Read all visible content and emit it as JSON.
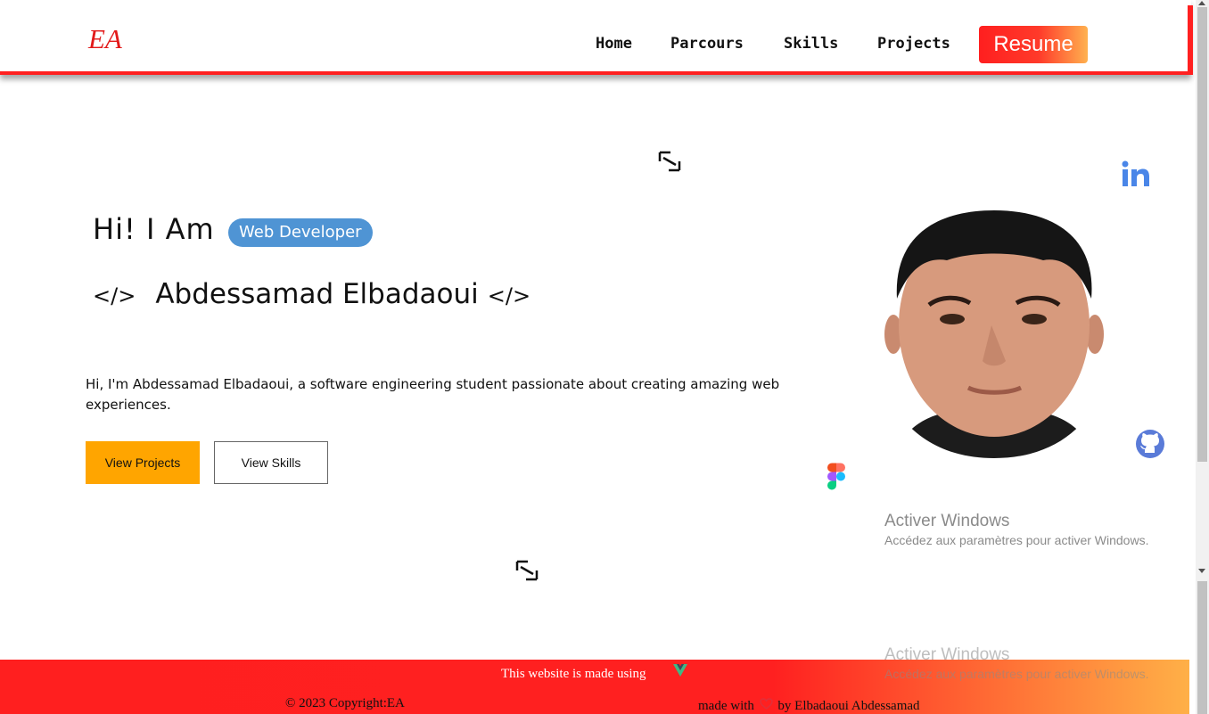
{
  "header": {
    "logo": "EA",
    "nav": [
      {
        "label": "Home"
      },
      {
        "label": "Parcours"
      },
      {
        "label": "Skills"
      },
      {
        "label": "Projects"
      }
    ],
    "resume_label": "Resume"
  },
  "hero": {
    "greeting": "Hi! I Am",
    "role_badge": "Web Developer",
    "code_open": "</>",
    "name": "Abdessamad Elbadaoui",
    "code_close": "</>",
    "intro": "Hi, I'm Abdessamad Elbadaoui, a software engineering student passionate about creating amazing web experiences.",
    "buttons": {
      "projects": "View Projects",
      "skills": "View Skills"
    }
  },
  "icons": {
    "linkedin": "linkedin-icon",
    "github": "github-icon",
    "figma": "figma-icon",
    "vue": "vue-icon",
    "deco": "resize-icon"
  },
  "watermark": {
    "title": "Activer Windows",
    "subtitle": "Accédez aux paramètres pour activer Windows."
  },
  "footer": {
    "made_using": "This website is made using",
    "copyright": "© 2023 Copyright:EA",
    "made_with": "made with",
    "by": "by Elbadaoui Abdessamad"
  },
  "colors": {
    "accent_red": "#ff2020",
    "accent_orange": "#ffa500",
    "badge_blue": "#4f94d4",
    "logo_red": "#e21a1a"
  }
}
